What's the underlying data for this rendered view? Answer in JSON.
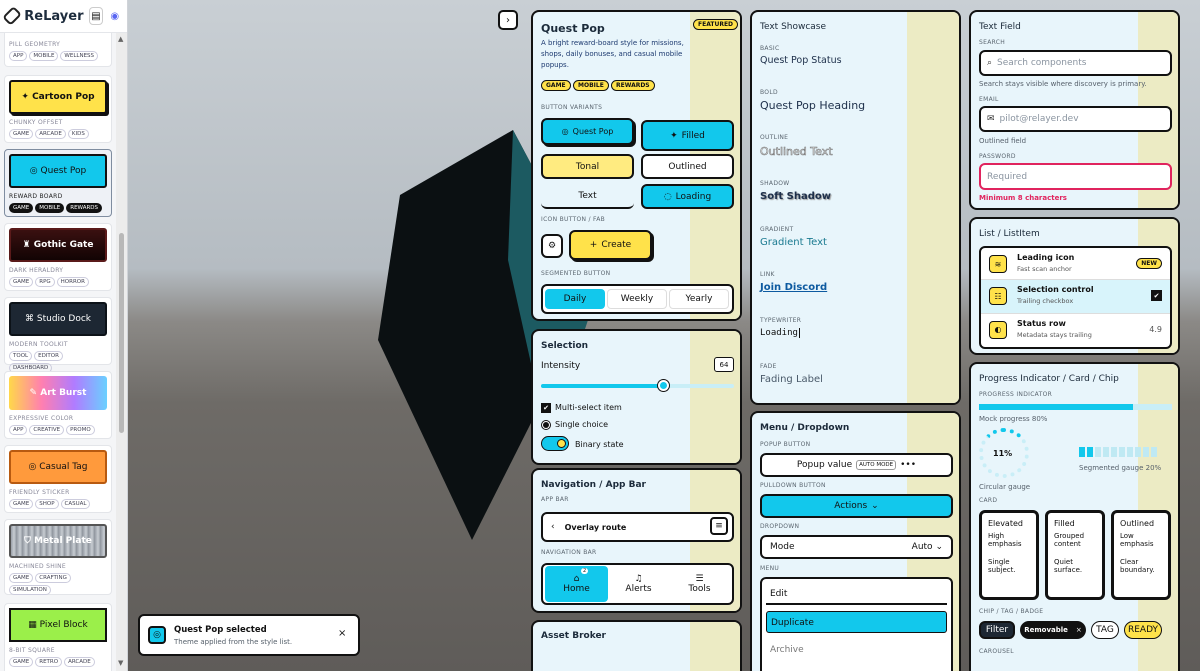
{
  "brand": {
    "name": "ReLayer",
    "book_icon": "book-icon",
    "discord_icon": "discord-icon"
  },
  "themes": [
    {
      "label": "",
      "caption": "Pill Geometry",
      "tags": [
        "APP",
        "MOBILE",
        "WELLNESS"
      ]
    },
    {
      "label": "Cartoon Pop",
      "caption": "Chunky Offset",
      "tags": [
        "GAME",
        "ARCADE",
        "KIDS"
      ]
    },
    {
      "label": "Quest Pop",
      "caption": "Reward Board",
      "tags": [
        "GAME",
        "MOBILE",
        "REWARDS"
      ]
    },
    {
      "label": "Gothic Gate",
      "caption": "Dark Heraldry",
      "tags": [
        "GAME",
        "RPG",
        "HORROR"
      ]
    },
    {
      "label": "Studio Dock",
      "caption": "Modern Toolkit",
      "tags": [
        "TOOL",
        "EDITOR",
        "DASHBOARD"
      ]
    },
    {
      "label": "Art Burst",
      "caption": "Expressive Color",
      "tags": [
        "APP",
        "CREATIVE",
        "PROMO"
      ]
    },
    {
      "label": "Casual Tag",
      "caption": "Friendly Sticker",
      "tags": [
        "GAME",
        "SHOP",
        "CASUAL"
      ]
    },
    {
      "label": "Metal Plate",
      "caption": "Machined Shine",
      "tags": [
        "GAME",
        "CRAFTING",
        "SIMULATION"
      ]
    },
    {
      "label": "Pixel Block",
      "caption": "8-Bit Square",
      "tags": [
        "GAME",
        "RETRO",
        "ARCADE"
      ]
    }
  ],
  "toast": {
    "title": "Quest Pop selected",
    "body": "Theme applied from the style list.",
    "close": "×"
  },
  "quest": {
    "title": "Quest Pop",
    "badge": "FEATURED",
    "desc": "A bright reward-board style for missions, shops, daily bonuses, and casual mobile popups.",
    "tags": [
      "GAME",
      "MOBILE",
      "REWARDS"
    ],
    "variants_label": "BUTTON VARIANTS",
    "b1": "Quest Pop",
    "b2": "Filled",
    "b3": "Tonal",
    "b4": "Outlined",
    "b5": "Text",
    "b6": "Loading",
    "fab_label": "ICON BUTTON / FAB",
    "create": "Create",
    "seg_label": "SEGMENTED BUTTON",
    "seg": [
      "Daily",
      "Weekly",
      "Yearly"
    ]
  },
  "selection": {
    "title": "Selection",
    "intensity_label": "Intensity",
    "intensity": 64,
    "multi": "Multi-select item",
    "single": "Single choice",
    "binary": "Binary state"
  },
  "nav": {
    "title": "Navigation / App Bar",
    "appbar_label": "APP BAR",
    "route": "Overlay route",
    "navbar_label": "NAVIGATION BAR",
    "tabs": [
      "Home",
      "Alerts",
      "Tools"
    ],
    "home_badge": "2"
  },
  "asset": {
    "title": "Asset Broker"
  },
  "text": {
    "title": "Text Showcase",
    "items": [
      {
        "cap": "BASIC",
        "val": "Quest Pop Status"
      },
      {
        "cap": "BOLD",
        "val": "Quest Pop Heading"
      },
      {
        "cap": "OUTLINE",
        "val": "Outlined Text"
      },
      {
        "cap": "SHADOW",
        "val": "Soft Shadow"
      },
      {
        "cap": "GRADIENT",
        "val": "Gradient Text"
      },
      {
        "cap": "LINK",
        "val": "Join Discord"
      },
      {
        "cap": "TYPEWRITER",
        "val": "Loading"
      },
      {
        "cap": "FADE",
        "val": "Fading Label"
      }
    ]
  },
  "menu": {
    "title": "Menu / Dropdown",
    "popup_label": "POPUP BUTTON",
    "popup": "Popup value",
    "automode": "AUTO MODE",
    "pull_label": "PULLDOWN BUTTON",
    "actions": "Actions",
    "drop_label": "DROPDOWN",
    "mode": "Mode",
    "auto": "Auto",
    "menu_label": "MENU",
    "items": [
      "Edit",
      "Duplicate",
      "Archive"
    ]
  },
  "textfield": {
    "title": "Text Field",
    "search_label": "SEARCH",
    "search_ph": "Search components",
    "search_help": "Search stays visible where discovery is primary.",
    "email_label": "EMAIL",
    "email_ph": "pilot@relayer.dev",
    "email_help": "Outlined field",
    "pw_label": "PASSWORD",
    "pw_ph": "Required",
    "pw_err": "Minimum 8 characters"
  },
  "list": {
    "title": "List / ListItem",
    "items": [
      {
        "t": "Leading icon",
        "s": "Fast scan anchor",
        "trail": "NEW"
      },
      {
        "t": "Selection control",
        "s": "Trailing checkbox",
        "trail": "✔"
      },
      {
        "t": "Status row",
        "s": "Metadata stays trailing",
        "trail": "4.9"
      }
    ]
  },
  "progress": {
    "title": "Progress Indicator / Card / Chip",
    "pi_label": "PROGRESS INDICATOR",
    "mock": "Mock progress 80%",
    "mock_value": 0.8,
    "circ_pct": "11%",
    "circ_label": "Circular gauge",
    "seg_label": "Segmented gauge 20%",
    "card_label": "CARD",
    "cards": [
      {
        "t": "Elevated",
        "a": "High emphasis",
        "b": "Single subject."
      },
      {
        "t": "Filled",
        "a": "Grouped content",
        "b": "Quiet surface."
      },
      {
        "t": "Outlined",
        "a": "Low emphasis",
        "b": "Clear boundary."
      }
    ],
    "chip_label": "CHIP / TAG / BADGE",
    "chips": [
      "Filter",
      "Removable",
      "TAG",
      "READY"
    ],
    "carousel": "CAROUSEL"
  },
  "colors": {
    "accent": "#12c8ec",
    "yellow": "#ffe24a",
    "error": "#e0245e"
  }
}
